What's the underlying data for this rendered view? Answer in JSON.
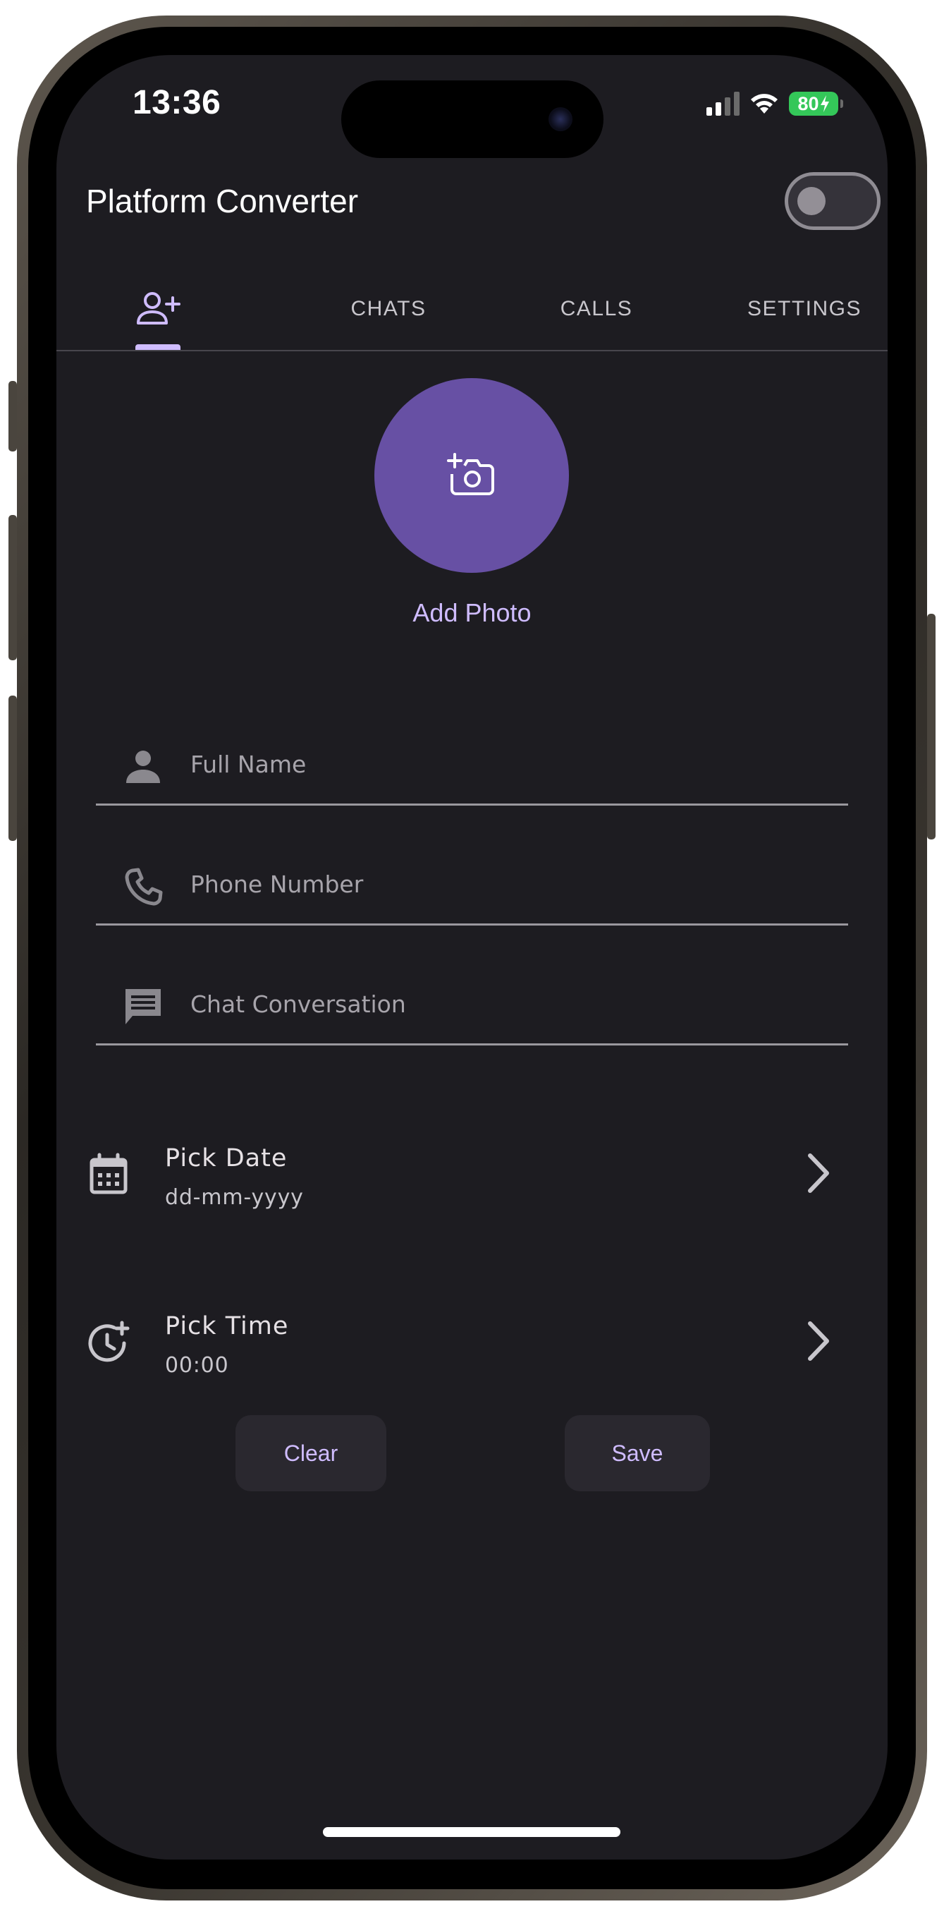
{
  "status_bar": {
    "time": "13:36",
    "battery": "80"
  },
  "app_bar": {
    "title": "Platform Converter",
    "theme_toggle_on": false
  },
  "tabs": [
    {
      "label": "",
      "icon": "person-add-icon",
      "selected": true
    },
    {
      "label": "CHATS",
      "selected": false
    },
    {
      "label": "CALLS",
      "selected": false
    },
    {
      "label": "SETTINGS",
      "selected": false
    }
  ],
  "photo": {
    "label": "Add Photo",
    "icon": "add-a-photo-icon"
  },
  "form": {
    "full_name_placeholder": "Full Name",
    "phone_placeholder": "Phone Number",
    "chat_placeholder": "Chat Conversation"
  },
  "pick_date": {
    "title": "Pick Date",
    "value": "dd-mm-yyyy",
    "icon": "calendar-icon"
  },
  "pick_time": {
    "title": "Pick Time",
    "value": "00:00",
    "icon": "schedule-add-icon"
  },
  "actions": {
    "clear_label": "Clear",
    "save_label": "Save"
  },
  "colors": {
    "background": "#1d1c21",
    "primary": "#cfbcff",
    "avatar": "#6750a4",
    "battery": "#34c759"
  }
}
